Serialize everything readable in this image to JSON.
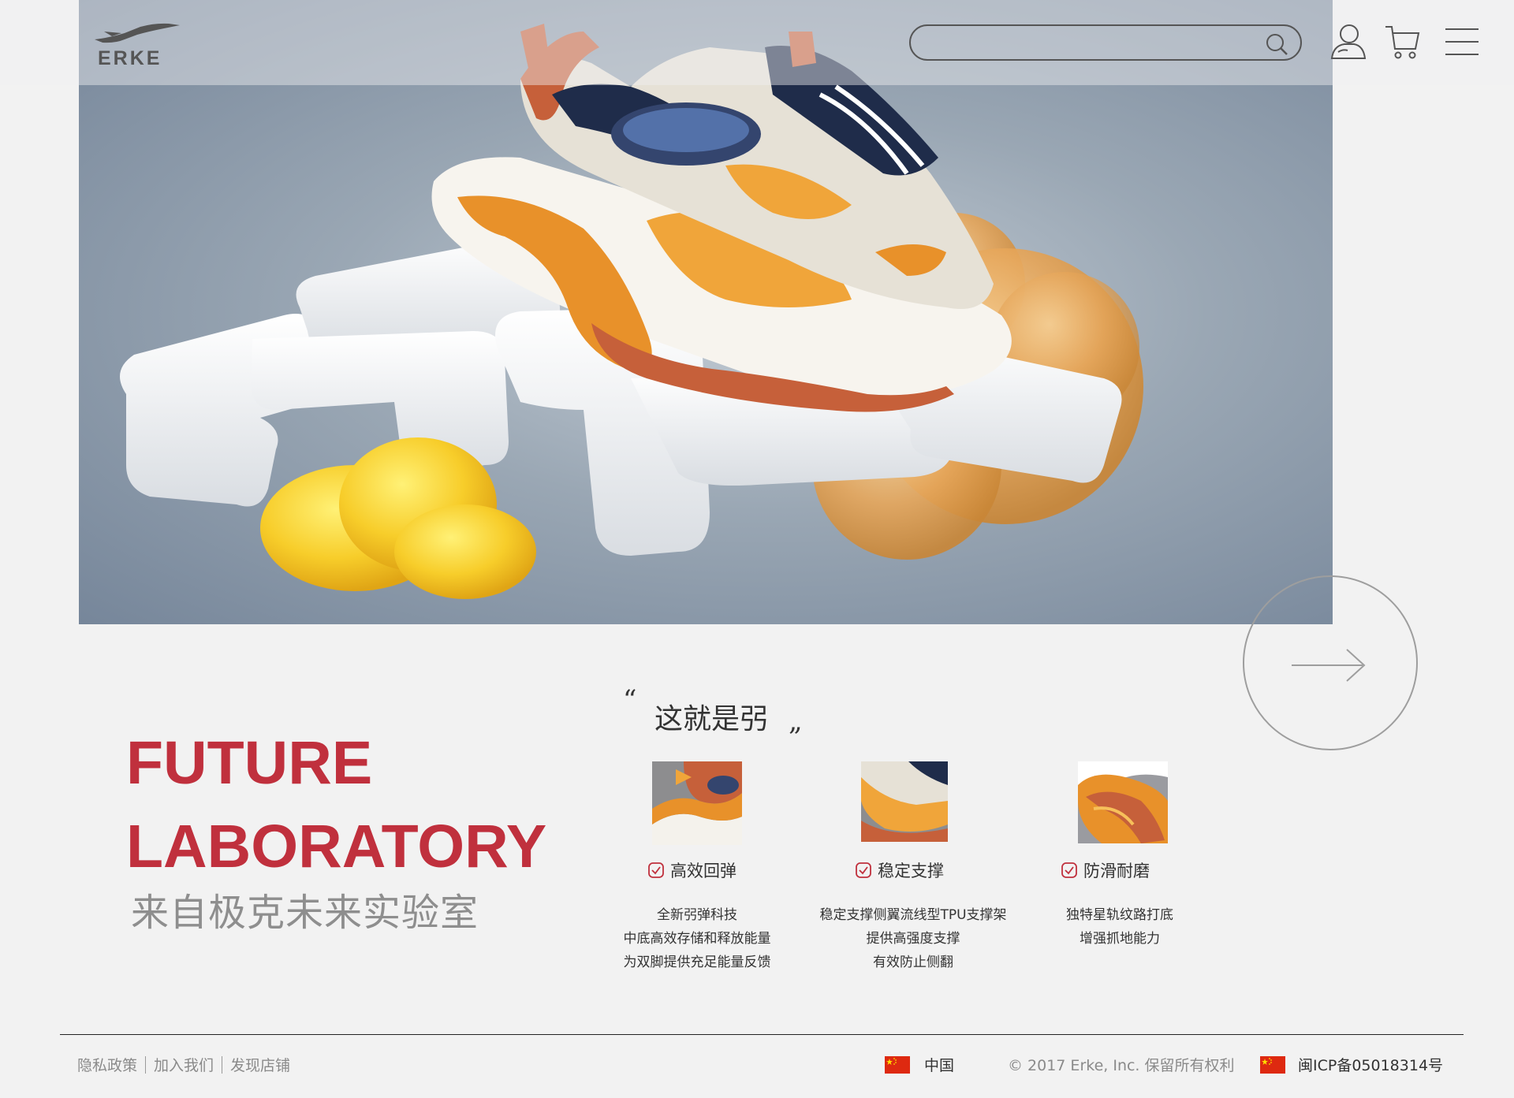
{
  "header": {
    "logo_text": "ERKE",
    "search": {
      "value": "",
      "placeholder": ""
    },
    "icons": [
      "user-icon",
      "cart-icon",
      "menu-icon"
    ]
  },
  "hero": {
    "alt": ""
  },
  "title": {
    "line1": "FUTURE",
    "line2": "LABORATORY",
    "subtitle": "来自极克未来实验室"
  },
  "quote": {
    "open": "“",
    "text": "这就是弜",
    "close": "„"
  },
  "features": [
    {
      "label": "高效回弹",
      "desc": [
        "全新弜弹科技",
        "中底高效存储和释放能量",
        "为双脚提供充足能量反馈"
      ]
    },
    {
      "label": "稳定支撑",
      "desc": [
        "稳定支撑侧翼流线型TPU支撑架",
        "提供高强度支撑",
        "有效防止侧翻"
      ]
    },
    {
      "label": "防滑耐磨",
      "desc": [
        "独特星轨纹路打底",
        "增强抓地能力"
      ]
    }
  ],
  "footer": {
    "links": [
      "隐私政策",
      "加入我们",
      "发现店铺"
    ],
    "region": "中国",
    "copyright": "© 2017 Erke, Inc. 保留所有权利",
    "icp": "闽ICP备05018314号"
  },
  "colors": {
    "accent_red": "#c0303d",
    "background": "#f2f2f2",
    "check_red": "#c0303d",
    "shoe_orange": "#e8912a",
    "shoe_rust": "#c6603a",
    "flag_red": "#de2910"
  }
}
